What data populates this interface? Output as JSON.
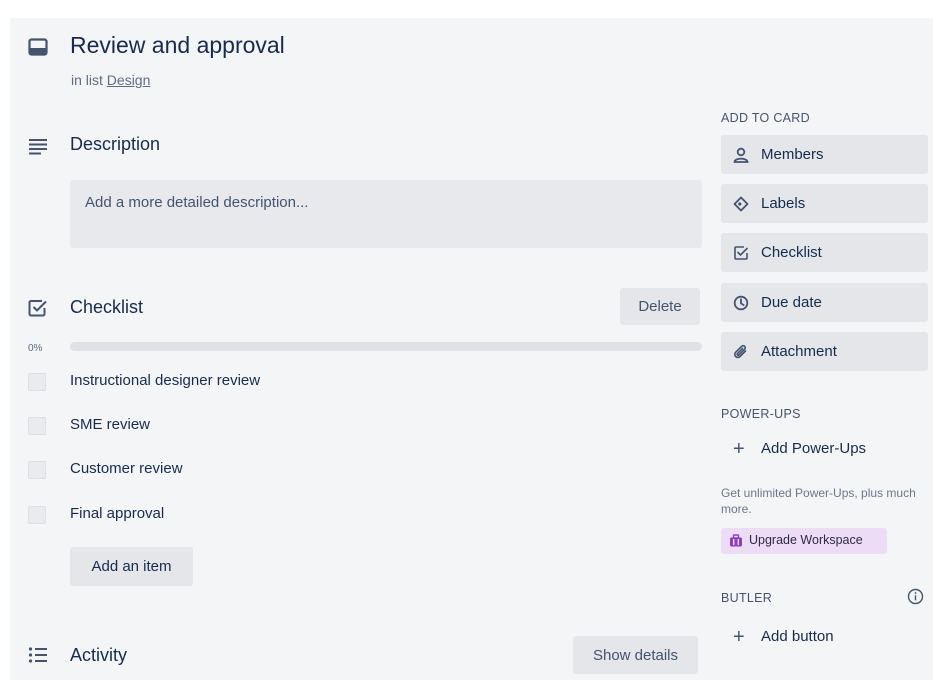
{
  "card": {
    "title": "Review and approval",
    "in_list_prefix": "in list",
    "list_name": "Design"
  },
  "description": {
    "title": "Description",
    "placeholder": "Add a more detailed description..."
  },
  "checklist": {
    "title": "Checklist",
    "delete_label": "Delete",
    "progress_label": "0%",
    "progress_value": 0,
    "items": [
      {
        "label": "Instructional designer review",
        "checked": false
      },
      {
        "label": "SME review",
        "checked": false
      },
      {
        "label": "Customer review",
        "checked": false
      },
      {
        "label": "Final approval",
        "checked": false
      }
    ],
    "add_item_label": "Add an item"
  },
  "activity": {
    "title": "Activity",
    "show_details_label": "Show details"
  },
  "sidebar": {
    "add_to_card_heading": "ADD TO CARD",
    "add_to_card": [
      {
        "label": "Members",
        "icon": "person-icon"
      },
      {
        "label": "Labels",
        "icon": "tag-icon"
      },
      {
        "label": "Checklist",
        "icon": "checkbox-icon"
      },
      {
        "label": "Due date",
        "icon": "clock-icon"
      },
      {
        "label": "Attachment",
        "icon": "paperclip-icon"
      }
    ],
    "powerups_heading": "POWER-UPS",
    "add_powerups_label": "Add Power-Ups",
    "promo_text": "Get unlimited Power-Ups, plus much more.",
    "upgrade_label": "Upgrade Workspace",
    "butler_heading": "BUTLER",
    "add_button_label": "Add button"
  },
  "colors": {
    "card_bg": "#f4f5f7",
    "button_bg": "#e4e6ea",
    "upgrade_bg": "#eddcf6",
    "upgrade_icon": "#8f3fb8",
    "text_primary": "#172b4d",
    "text_muted": "#5e6c84"
  }
}
